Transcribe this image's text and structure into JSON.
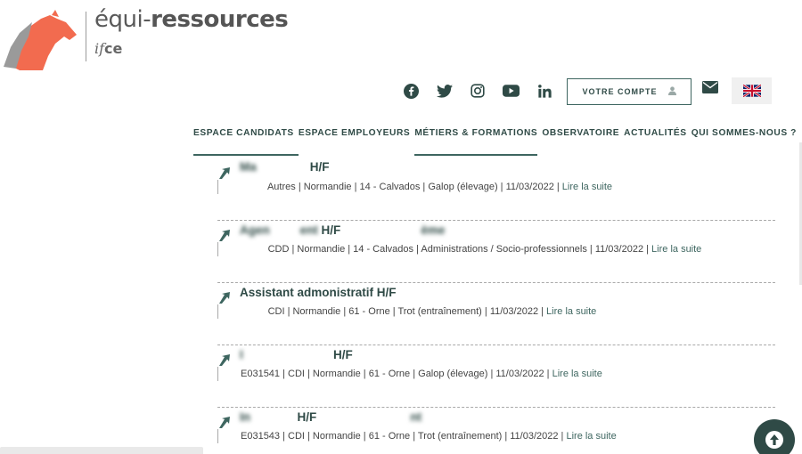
{
  "brand": {
    "title_light": "équi-",
    "title_bold": "ressources",
    "sub_italic": "if",
    "sub_bold": "ce",
    "logo_color": "#f26b4f"
  },
  "header": {
    "social": [
      {
        "icon": "facebook-icon"
      },
      {
        "icon": "twitter-icon"
      },
      {
        "icon": "instagram-icon"
      },
      {
        "icon": "youtube-icon"
      },
      {
        "icon": "linkedin-icon"
      }
    ],
    "account_label": "VOTRE COMPTE",
    "mail_icon": "mail-icon",
    "language_icon": "uk-flag-icon"
  },
  "nav": {
    "items": [
      "ESPACE CANDIDATS",
      "ESPACE EMPLOYEURS",
      "MÉTIERS & FORMATIONS",
      "OBSERVATOIRE",
      "ACTUALITÉS",
      "QUI SOMMES-NOUS ?"
    ]
  },
  "listings": [
    {
      "title": "H/F",
      "meta": "Autres | Normandie | 14 - Calvados | Galop (élevage) | 11/03/2022 |",
      "link": "Lire la suite"
    },
    {
      "title": "H/F",
      "meta": "CDD | Normandie | 14 - Calvados | Administrations / Socio-professionnels | 11/03/2022 |",
      "link": "Lire la suite"
    },
    {
      "title": "Assistant admonistratif H/F",
      "meta": "CDI | Normandie | 61 - Orne | Trot (entraînement) | 11/03/2022 |",
      "link": "Lire la suite"
    },
    {
      "title": "H/F",
      "meta": "E031541 | CDI | Normandie | 61 - Orne | Galop (élevage) | 11/03/2022 |",
      "link": "Lire la suite"
    },
    {
      "title": "H/F",
      "meta": "E031543 | CDI | Normandie | 61 - Orne | Trot (entraînement) | 11/03/2022 |",
      "link": "Lire la suite"
    }
  ],
  "colors": {
    "accent": "#2f4a46",
    "logo": "#f26b4f"
  }
}
